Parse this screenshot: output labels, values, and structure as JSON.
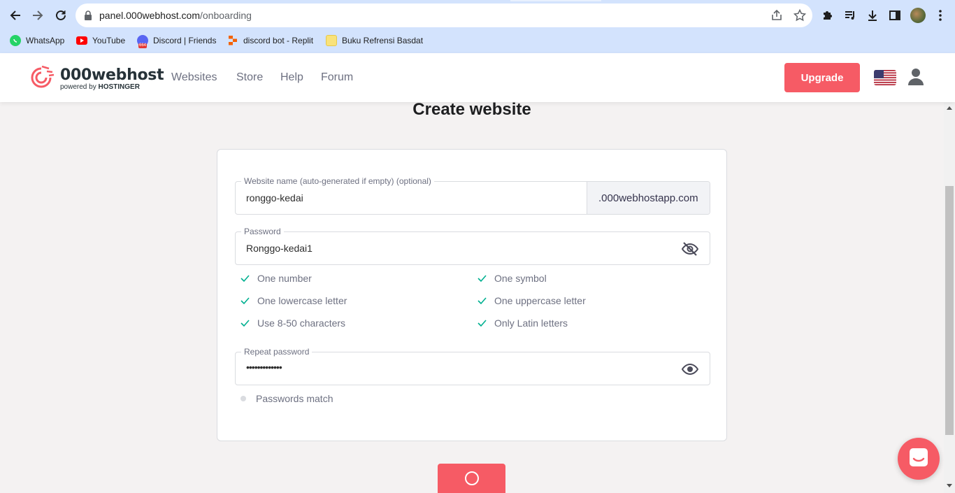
{
  "browser": {
    "url_host": "panel.000webhost.com",
    "url_path": "/onboarding",
    "bookmarks": [
      {
        "label": "WhatsApp",
        "icon": "whatsapp-icon"
      },
      {
        "label": "YouTube",
        "icon": "youtube-icon"
      },
      {
        "label": "Discord | Friends",
        "icon": "discord-icon"
      },
      {
        "label": "discord bot - Replit",
        "icon": "replit-icon"
      },
      {
        "label": "Buku Refrensi Basdat",
        "icon": "folder-icon"
      }
    ]
  },
  "header": {
    "logo_main": "000webhost",
    "logo_sub_prefix": "powered by",
    "logo_sub_brand": "HOSTINGER",
    "nav": [
      "Websites",
      "Store",
      "Help",
      "Forum"
    ],
    "upgrade_label": "Upgrade"
  },
  "page": {
    "title": "Create website"
  },
  "form": {
    "website_name": {
      "label": "Website name (auto-generated if empty) (optional)",
      "value": "ronggo-kedai",
      "suffix": ".000webhostapp.com"
    },
    "password": {
      "label": "Password",
      "value": "Ronggo-kedai1"
    },
    "requirements": [
      "One number",
      "One symbol",
      "One lowercase letter",
      "One uppercase letter",
      "Use 8-50 characters",
      "Only Latin letters"
    ],
    "repeat_password": {
      "label": "Repeat password",
      "value": "•••••••••••••"
    },
    "match_label": "Passwords match"
  },
  "colors": {
    "accent": "#f65b65",
    "check": "#00b090"
  }
}
